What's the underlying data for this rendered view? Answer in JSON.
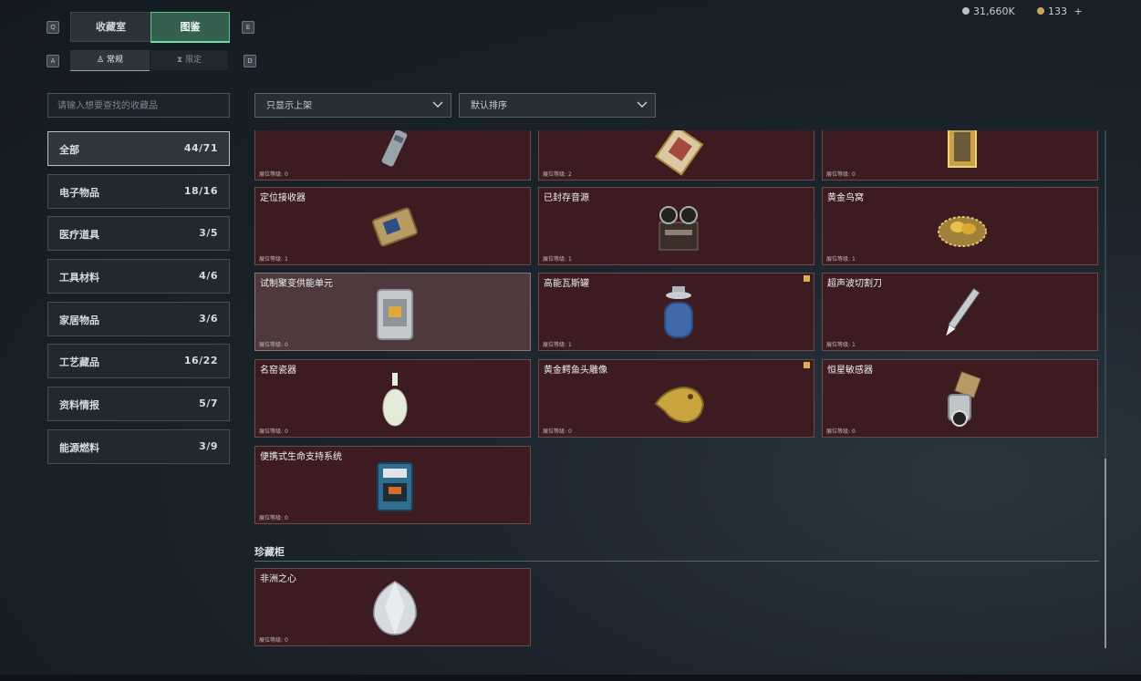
{
  "header": {
    "tabs": [
      {
        "label": "收藏室"
      },
      {
        "label": "图鉴"
      }
    ],
    "subtabs": [
      {
        "label": "常规"
      },
      {
        "label": "限定"
      }
    ],
    "keys": {
      "prev": "Q",
      "next": "E",
      "sub_prev": "A",
      "sub_next": "D"
    },
    "currency": [
      {
        "value": "31,660K",
        "icon": "silver-coin-icon"
      },
      {
        "value": "133",
        "icon": "gold-coin-icon",
        "plus": "+"
      }
    ]
  },
  "search": {
    "placeholder": "请输入想要查找的收藏品"
  },
  "filters": [
    {
      "value": "只显示上架"
    },
    {
      "value": "默认排序"
    }
  ],
  "categories": [
    {
      "label": "全部",
      "count": "44/71"
    },
    {
      "label": "电子物品",
      "count": "18/16"
    },
    {
      "label": "医疗道具",
      "count": "3/5"
    },
    {
      "label": "工具材料",
      "count": "4/6"
    },
    {
      "label": "家居物品",
      "count": "3/6"
    },
    {
      "label": "工艺藏品",
      "count": "16/22"
    },
    {
      "label": "资料情报",
      "count": "5/7"
    },
    {
      "label": "能源燃料",
      "count": "3/9"
    }
  ],
  "level_prefix": "展位等级:",
  "items": [
    {
      "name": "",
      "level": "0",
      "icon": "flashlight-icon"
    },
    {
      "name": "",
      "level": "2",
      "icon": "painting-card-icon"
    },
    {
      "name": "",
      "level": "0",
      "icon": "golden-frame-icon"
    },
    {
      "name": "定位接收器",
      "level": "1",
      "icon": "receiver-icon"
    },
    {
      "name": "已封存音源",
      "level": "1",
      "icon": "tape-recorder-icon"
    },
    {
      "name": "黄金鸟窝",
      "level": "1",
      "icon": "golden-nest-icon"
    },
    {
      "name": "试制聚变供能单元",
      "level": "0",
      "icon": "fusion-unit-icon"
    },
    {
      "name": "高能瓦斯罐",
      "level": "1",
      "icon": "gas-tank-icon"
    },
    {
      "name": "超声波切割刀",
      "level": "1",
      "icon": "cutter-icon"
    },
    {
      "name": "名窑瓷器",
      "level": "0",
      "icon": "porcelain-vase-icon"
    },
    {
      "name": "黄金鳄鱼头雕像",
      "level": "0",
      "icon": "gold-statue-icon"
    },
    {
      "name": "恒星敏感器",
      "level": "0",
      "icon": "star-sensor-icon"
    },
    {
      "name": "便携式生命支持系统",
      "level": "0",
      "icon": "life-support-icon"
    }
  ],
  "treasure": {
    "title": "珍藏柜",
    "items": [
      {
        "name": "非洲之心",
        "level": "0",
        "icon": "diamond-icon"
      }
    ]
  },
  "colors": {
    "accent": "#58c38d",
    "card": "#3d1c21",
    "badge": "#d9b24a"
  }
}
